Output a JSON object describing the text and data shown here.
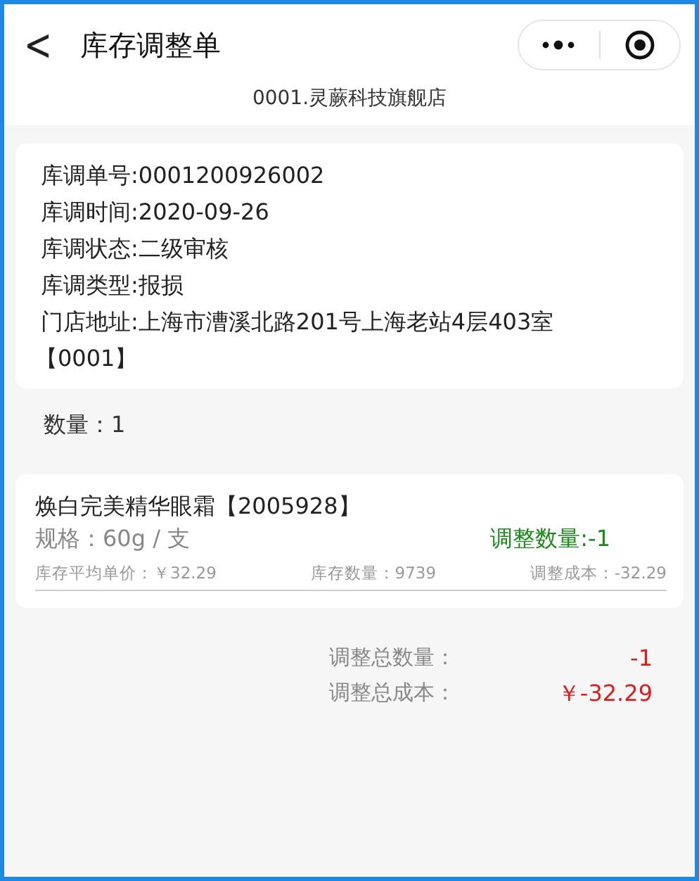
{
  "nav": {
    "back": "<",
    "title": "库存调整单"
  },
  "store": "0001.灵蕨科技旗舰店",
  "info": [
    {
      "label": "库调单号:",
      "value": "0001200926002"
    },
    {
      "label": "库调时间:",
      "value": "2020-09-26"
    },
    {
      "label": "库调状态:",
      "value": "二级审核"
    },
    {
      "label": "库调类型:",
      "value": "报损"
    },
    {
      "label": "门店地址:",
      "value": "上海市漕溪北路201号上海老站4层403室",
      "code": "【0001】"
    }
  ],
  "count": "数量：1",
  "items": [
    {
      "name": "焕白完美精华眼霜【2005928】",
      "spec": "规格：60g / 支",
      "adjust_qty": "调整数量:-1",
      "avg_price": "库存平均单价：￥32.29",
      "stock": "库存数量：9739",
      "cost": "调整成本：-32.29"
    }
  ],
  "totals": [
    {
      "label": "调整总数量：",
      "value": "-1"
    },
    {
      "label": "调整总成本：",
      "value": "￥-32.29"
    }
  ]
}
